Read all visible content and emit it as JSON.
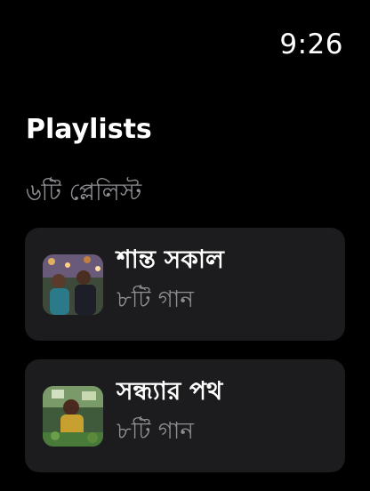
{
  "status": {
    "time": "9:26"
  },
  "header": {
    "title": "Playlists",
    "subtitle": "৬টি প্লেলিস্ট"
  },
  "playlists": [
    {
      "title": "শান্ত সকাল",
      "count": "৮টি গান"
    },
    {
      "title": "সন্ধ্যার পথ",
      "count": "৮টি গান"
    }
  ]
}
